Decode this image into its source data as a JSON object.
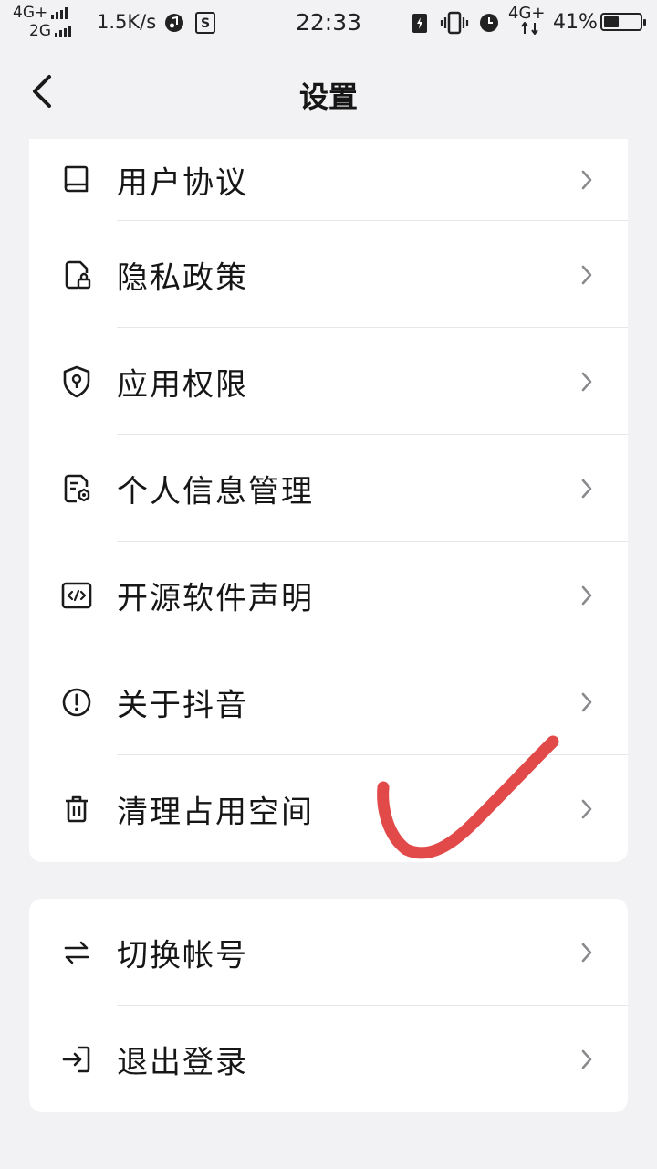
{
  "status_bar": {
    "net1": "4G+",
    "net2": "2G",
    "speed": "1.5K/s",
    "time": "22:33",
    "net3": "4G+",
    "battery_percent_text": "41%",
    "battery_level": 0.41
  },
  "header": {
    "title": "设置"
  },
  "card1": {
    "items": [
      {
        "label": "用户协议",
        "icon": "book-icon"
      },
      {
        "label": "隐私政策",
        "icon": "document-lock-icon"
      },
      {
        "label": "应用权限",
        "icon": "shield-icon"
      },
      {
        "label": "个人信息管理",
        "icon": "document-settings-icon"
      },
      {
        "label": "开源软件声明",
        "icon": "code-icon"
      },
      {
        "label": "关于抖音",
        "icon": "info-icon"
      },
      {
        "label": "清理占用空间",
        "icon": "trash-icon"
      }
    ]
  },
  "card2": {
    "items": [
      {
        "label": "切换帐号",
        "icon": "swap-icon"
      },
      {
        "label": "退出登录",
        "icon": "logout-icon"
      }
    ]
  },
  "colors": {
    "background": "#f2f2f4",
    "card": "#ffffff",
    "annotation": "#e03a3a"
  }
}
